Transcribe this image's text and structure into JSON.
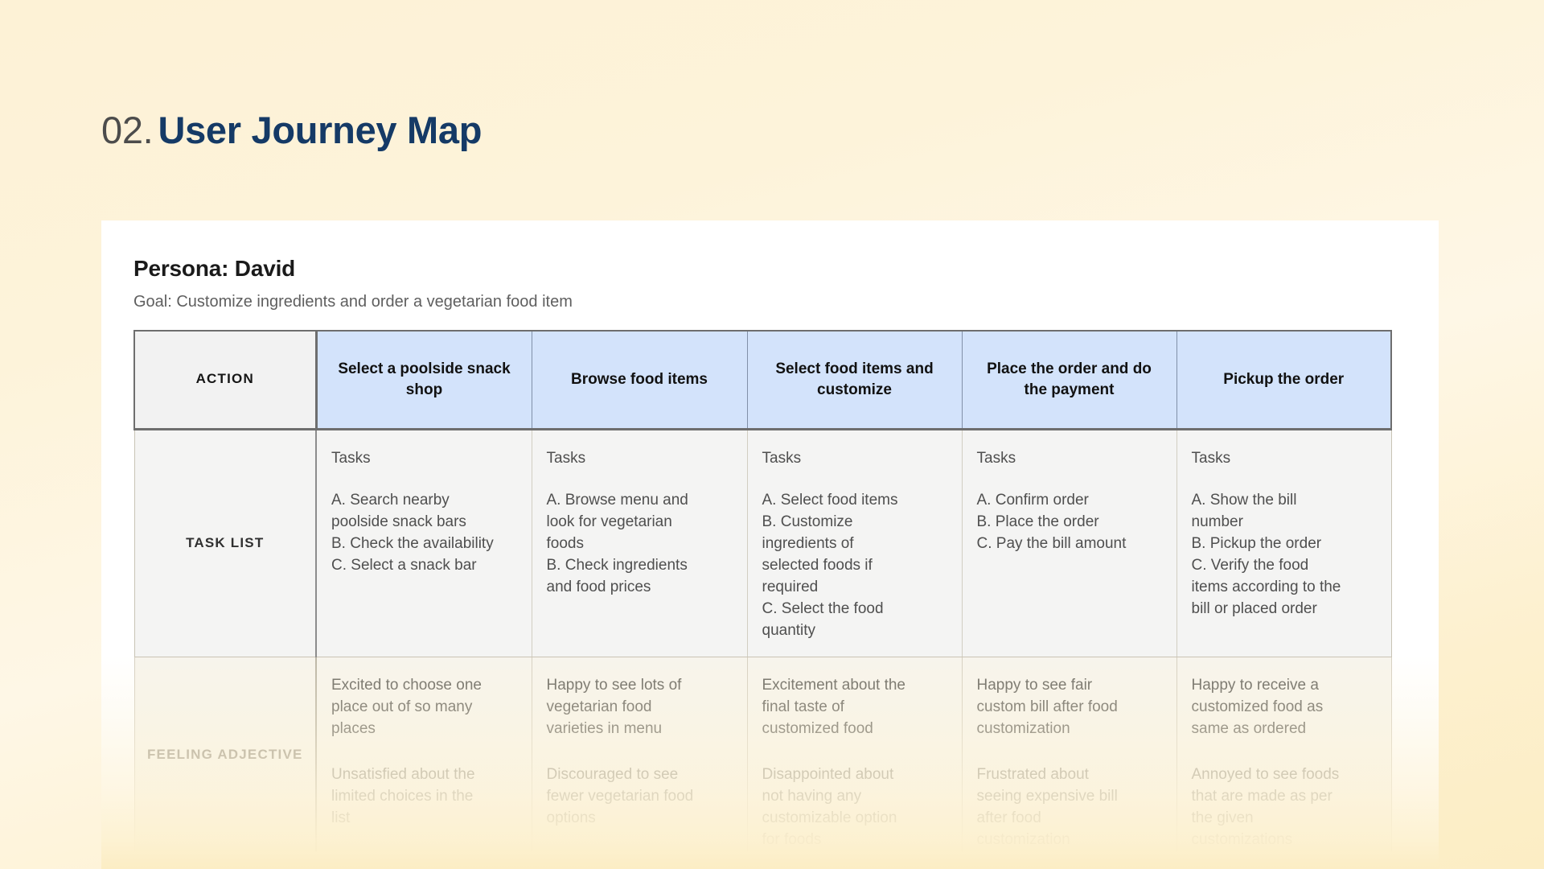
{
  "heading": {
    "number": "02.",
    "title": "User Journey Map"
  },
  "card": {
    "persona": "Persona: David",
    "goal": "Goal: Customize ingredients and order a vegetarian food item"
  },
  "table": {
    "row_labels": {
      "action": "ACTION",
      "task_list": "TASK LIST",
      "feeling_adjective": "FEELING\nADJECTIVE"
    },
    "tasks_label": "Tasks",
    "columns": [
      {
        "action": "Select a poolside\nsnack shop",
        "tasks": "A. Search nearby\npoolside snack bars\nB. Check the availability\nC. Select a snack bar",
        "feeling_positive": "Excited to choose one\nplace out of so many\nplaces",
        "feeling_negative": "Unsatisfied about the\nlimited choices in the\nlist"
      },
      {
        "action": "Browse food items",
        "tasks": "A. Browse menu and\nlook for vegetarian\nfoods\nB. Check ingredients\nand food prices",
        "feeling_positive": "Happy to see lots of\nvegetarian food\nvarieties in menu",
        "feeling_negative": "Discouraged to see\nfewer vegetarian food\noptions"
      },
      {
        "action": "Select food items\nand customize",
        "tasks": "A. Select food items\nB. Customize\ningredients of\nselected foods if\nrequired\nC. Select the food\nquantity",
        "feeling_positive": "Excitement about the\nfinal taste of\ncustomized food",
        "feeling_negative": "Disappointed about\nnot having any\ncustomizable option\nfor foods"
      },
      {
        "action": "Place the order and\ndo the payment",
        "tasks": "A. Confirm order\nB. Place the order\nC. Pay the bill amount",
        "feeling_positive": "Happy to see fair\ncustom bill after food\ncustomization",
        "feeling_negative": "Frustrated about\nseeing expensive bill\nafter food\ncustomization"
      },
      {
        "action": "Pickup the order",
        "tasks": "A. Show the bill\nnumber\nB. Pickup the order\nC. Verify the food\nitems according to the\nbill or placed order",
        "feeling_positive": "Happy to receive a\ncustomized food as\nsame as ordered",
        "feeling_negative": "Annoyed to see foods\nthat are made as per\nthe given\ncustomizations"
      }
    ]
  },
  "colors": {
    "page_background": "#FDF3D8",
    "heading_number": "#4C4C4C",
    "heading_title": "#153A66",
    "card_background": "#FFFFFF",
    "action_header_background": "#D3E3FB",
    "row_label_background": "#F2F2F2",
    "task_row_background": "#F4F4F3",
    "feeling_row_background": "#F7F4EC",
    "table_border": "#6E6E6E"
  }
}
